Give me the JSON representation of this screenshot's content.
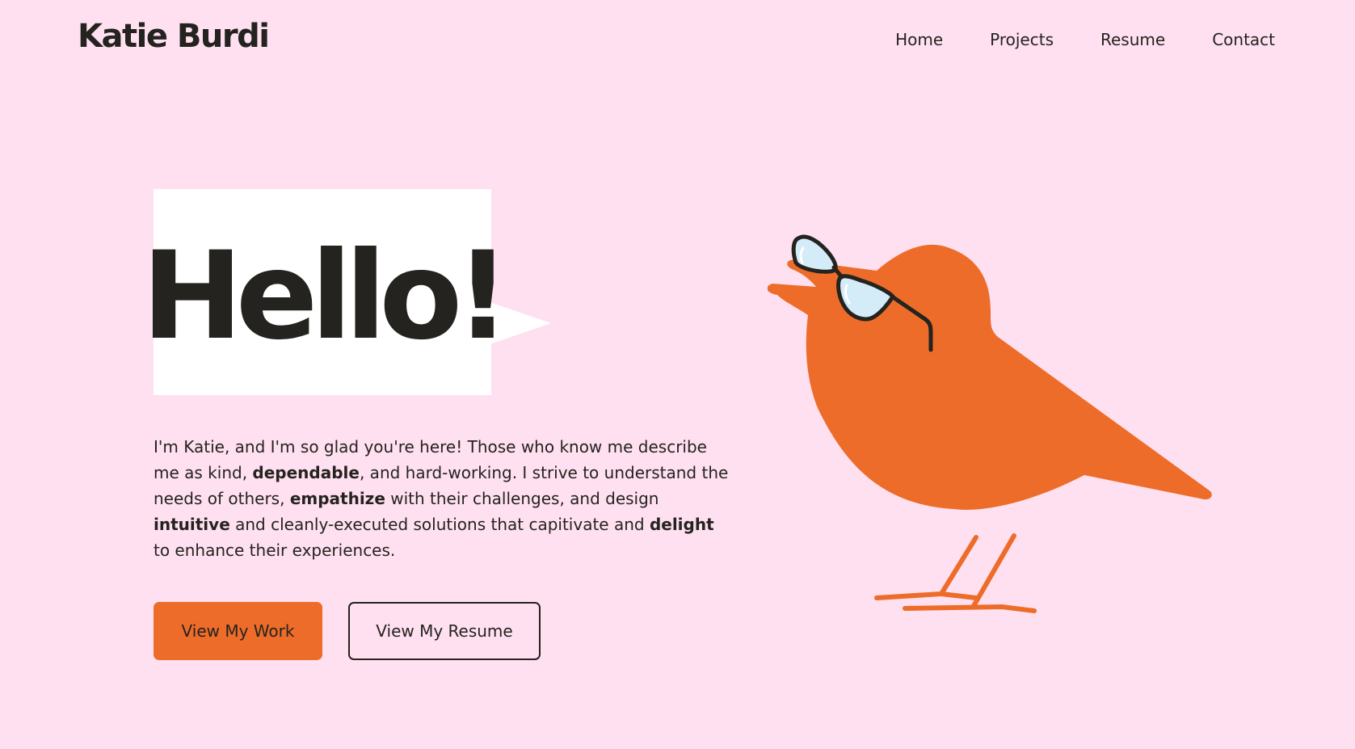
{
  "header": {
    "logo": "Katie Burdi",
    "nav": [
      {
        "label": "Home"
      },
      {
        "label": "Projects"
      },
      {
        "label": "Resume"
      },
      {
        "label": "Contact"
      }
    ]
  },
  "hero": {
    "greeting": "Hello!",
    "intro": {
      "p1": "I'm Katie, and I'm so glad you're here! Those who know me describe me as kind, ",
      "b1": "dependable",
      "p2": ", and hard-working. I strive to understand the needs of others, ",
      "b2": "empathize",
      "p3": " with their challenges, and design ",
      "b3": "intuitive",
      "p4": " and cleanly-executed solutions that capitivate and ",
      "b4": "delight",
      "p5": " to enhance their experiences."
    },
    "buttons": {
      "primary": "View My Work",
      "secondary": "View My Resume"
    },
    "illustration": {
      "name": "orange-bird-with-glasses",
      "colors": {
        "body": "#ee6c29",
        "lens": "#d4ecf8",
        "frame": "#24231f"
      }
    }
  },
  "colors": {
    "background": "#ffe0f0",
    "text": "#24231f",
    "accent": "#ee6c29",
    "bubble": "#ffffff"
  }
}
